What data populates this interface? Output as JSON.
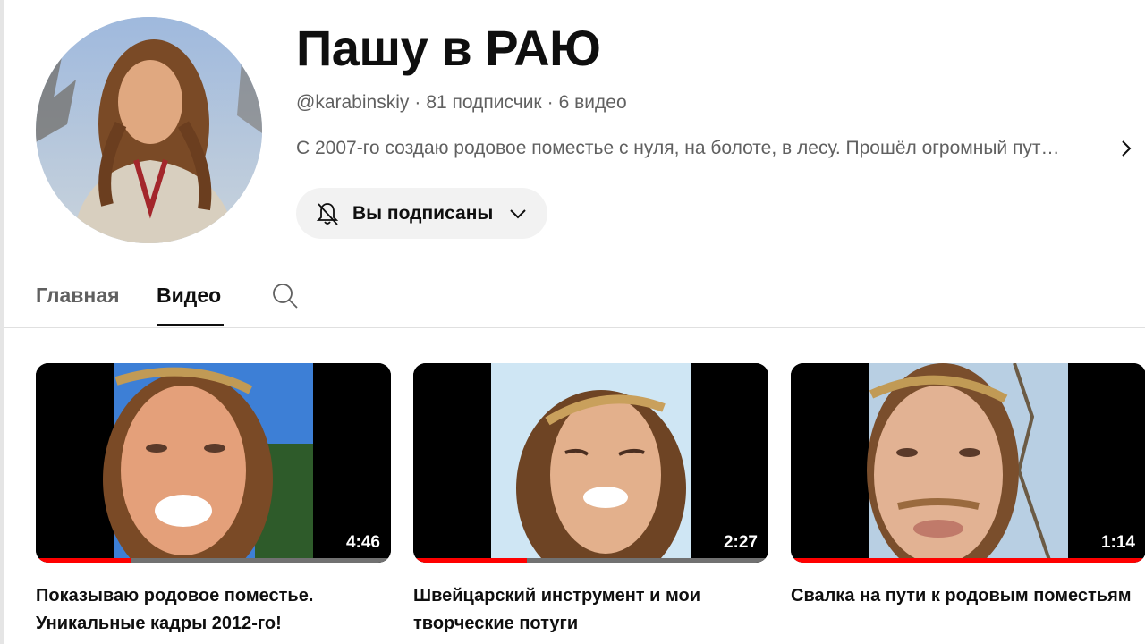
{
  "channel": {
    "title": "Пашу в РАЮ",
    "handle": "@karabinskiy",
    "separator": "·",
    "subscribers": "81 подписчик",
    "video_count": "6 видео",
    "description": "С 2007-го создаю родовое поместье с нуля, на болоте, в лесу. Прошёл огромный пут…",
    "subscribe_label": "Вы подписаны"
  },
  "tabs": [
    {
      "label": "Главная",
      "active": false
    },
    {
      "label": "Видео",
      "active": true
    }
  ],
  "icons": {
    "bell": "bell-off-icon",
    "chevron": "chevron-down-icon",
    "more": "chevron-right-icon",
    "search": "search-icon"
  },
  "colors": {
    "progress": "#ff0000",
    "subscribe_bg": "#f2f2f2"
  },
  "videos": [
    {
      "title": "Показываю родовое поместье. Уникальные кадры 2012-го!",
      "duration": "4:46",
      "progress": 0.27
    },
    {
      "title": "Швейцарский инструмент и мои творческие потуги",
      "duration": "2:27",
      "progress": 0.32
    },
    {
      "title": "Свалка на пути к родовым поместьям",
      "duration": "1:14",
      "progress": 1.0
    }
  ]
}
